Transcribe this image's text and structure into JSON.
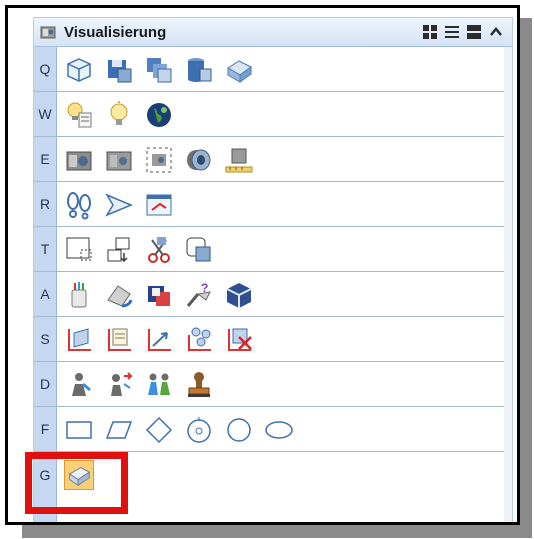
{
  "panel": {
    "title": "Visualisierung",
    "title_icon": "camera-icon",
    "controls": [
      "grid-view-icon",
      "list-view-icon",
      "compact-view-icon",
      "collapse-icon"
    ]
  },
  "rows": [
    {
      "key": "Q",
      "icons": [
        "cube-outline-icon",
        "cube-save-icon",
        "cube-stack-icon",
        "cylinder-render-icon",
        "cube-tilted-icon"
      ]
    },
    {
      "key": "W",
      "icons": [
        "lightbulb-list-icon",
        "lightbulb-icon",
        "globe-icon"
      ]
    },
    {
      "key": "E",
      "icons": [
        "camera-icon",
        "camera-settings-icon",
        "camera-frame-icon",
        "lens-icon",
        "camera-ruler-icon"
      ]
    },
    {
      "key": "R",
      "icons": [
        "footprints-icon",
        "arrow-walk-icon",
        "window-link-icon"
      ]
    },
    {
      "key": "T",
      "icons": [
        "select-rect-icon",
        "move-block-icon",
        "scissors-icon",
        "copy-shape-icon"
      ]
    },
    {
      "key": "A",
      "icons": [
        "paint-bucket-icon",
        "paint-spill-icon",
        "material-cube-icon",
        "paint-query-icon",
        "texture-cube-icon"
      ]
    },
    {
      "key": "S",
      "icons": [
        "axis-plane-icon",
        "axis-list-icon",
        "axis-arrow-icon",
        "axis-network-icon",
        "axis-delete-icon"
      ]
    },
    {
      "key": "D",
      "icons": [
        "person-icon",
        "person-arrows-icon",
        "people-icon",
        "stamp-icon"
      ]
    },
    {
      "key": "F",
      "icons": [
        "rectangle-icon",
        "parallelogram-icon",
        "diamond-icon",
        "circle-dot-icon",
        "circle-icon",
        "ellipse-icon"
      ]
    },
    {
      "key": "G",
      "icons": [
        "selected-tool-icon"
      ]
    }
  ],
  "colors": {
    "highlight": "#e01010",
    "keycol": "#c6d8f1",
    "selected": "#f9cf7a"
  }
}
